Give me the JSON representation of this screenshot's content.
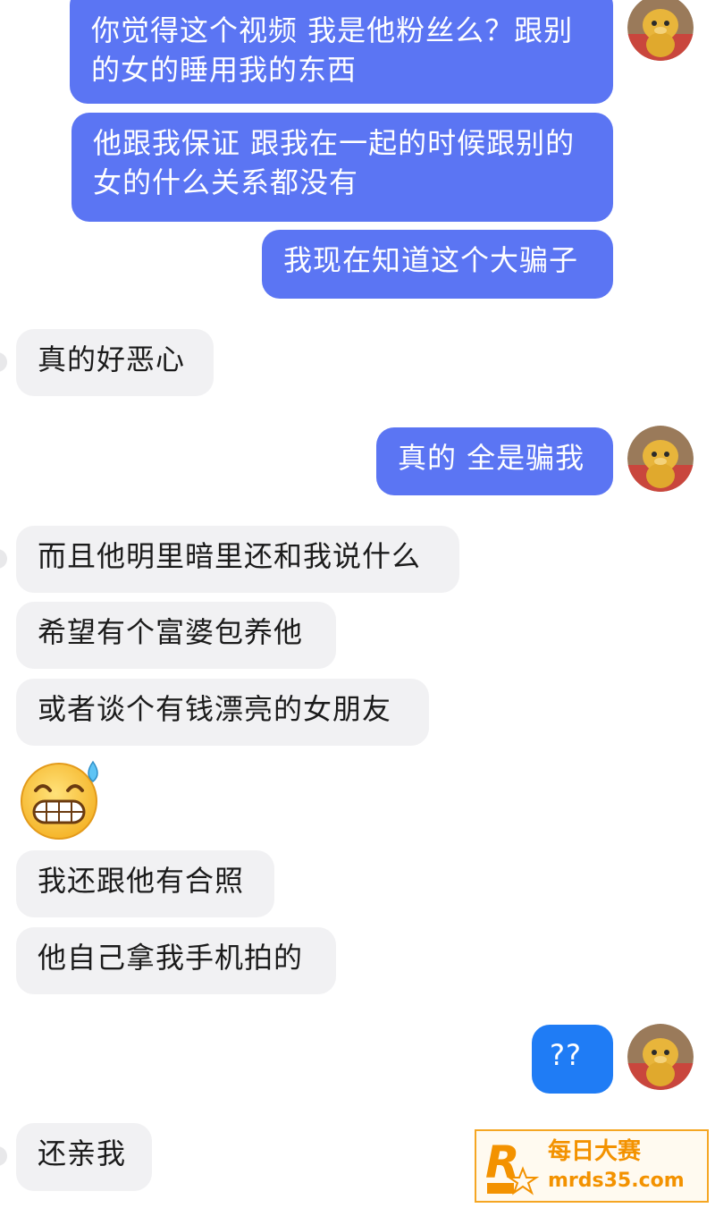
{
  "messages": [
    {
      "side": "out",
      "text": "你觉得这个视频 我是他粉丝么？跟别的女的睡用我的东西"
    },
    {
      "side": "out",
      "text": "他跟我保证 跟我在一起的时候跟别的女的什么关系都没有"
    },
    {
      "side": "out",
      "text": "我现在知道这个大骗子"
    },
    {
      "side": "in",
      "text": "真的好恶心"
    },
    {
      "side": "out",
      "text": "真的 全是骗我"
    },
    {
      "side": "in",
      "text": "而且他明里暗里还和我说什么"
    },
    {
      "side": "in",
      "text": "希望有个富婆包养他"
    },
    {
      "side": "in",
      "text": "或者谈个有钱漂亮的女朋友"
    },
    {
      "side": "in",
      "type": "emoji",
      "emoji": "grimacing-sweat-emoji"
    },
    {
      "side": "in",
      "text": "我还跟他有合照"
    },
    {
      "side": "in",
      "text": "他自己拿我手机拍的"
    },
    {
      "side": "out",
      "text": "??"
    },
    {
      "side": "in",
      "text": "还亲我"
    }
  ],
  "watermark": {
    "logo_letter": "R",
    "logo_small": "每日大赛",
    "title": "每日大赛",
    "url": "mrds35.com"
  },
  "colors": {
    "outgoing_bubble": "#5b75f3",
    "outgoing_bubble_alt": "#1f7cf5",
    "incoming_bubble": "#f1f1f3",
    "watermark_accent": "#f39200"
  }
}
